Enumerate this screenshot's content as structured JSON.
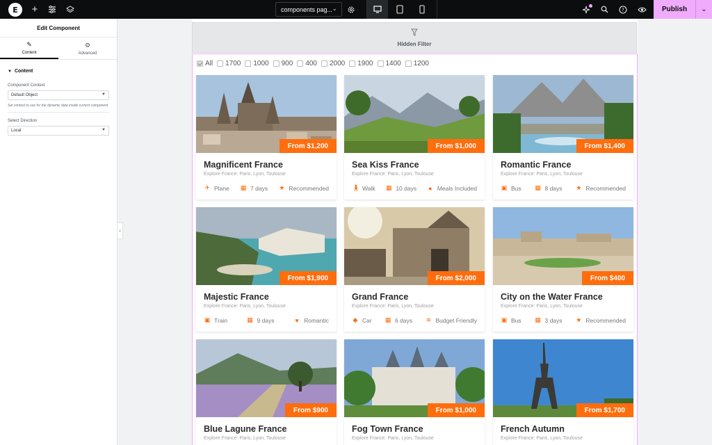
{
  "topbar": {
    "logo_letter": "E",
    "page_name": "components pag...",
    "publish_label": "Publish",
    "accent": "#f0abfc"
  },
  "panel": {
    "title": "Edit Component",
    "tabs": [
      {
        "label": "Content",
        "icon": "pencil-icon"
      },
      {
        "label": "Advanced",
        "icon": "gear-icon"
      }
    ],
    "section": "Content",
    "controls": {
      "context_label": "Component Context",
      "context_value": "Default Object",
      "context_help": "Set context to use for the dynamic data inside current component",
      "direction_label": "Select Direction",
      "direction_value": "Local"
    }
  },
  "canvas": {
    "hidden_filter_label": "Hidden Filter",
    "filters": [
      "All",
      "1700",
      "1000",
      "900",
      "400",
      "2000",
      "1900",
      "1400",
      "1200"
    ],
    "accent": "#ff6d0d"
  },
  "cards": [
    {
      "title": "Magnificent France",
      "subtitle": "Explore France: Paris, Lyon, Toulouse",
      "price": "From $1,200",
      "meta": [
        "Plane",
        "7 days",
        "Recommended"
      ],
      "icons": [
        "plane-icon",
        "calendar-icon",
        "star-icon"
      ]
    },
    {
      "title": "Sea Kiss France",
      "subtitle": "Explore France: Paris, Lyon, Toulouse",
      "price": "From $1,000",
      "meta": [
        "Walk",
        "10 days",
        "Meals Included"
      ],
      "icons": [
        "walk-icon",
        "calendar-icon",
        "apple-icon"
      ]
    },
    {
      "title": "Romantic France",
      "subtitle": "Explore France: Paris, Lyon, Toulouse",
      "price": "From $1,400",
      "meta": [
        "Bus",
        "8 days",
        "Recommended"
      ],
      "icons": [
        "bus-icon",
        "calendar-icon",
        "star-icon"
      ]
    },
    {
      "title": "Majestic France",
      "subtitle": "Explore France: Paris, Lyon, Toulouse",
      "price": "From $1,900",
      "meta": [
        "Train",
        "9 days",
        "Romantic"
      ],
      "icons": [
        "train-icon",
        "calendar-icon",
        "heart-icon"
      ]
    },
    {
      "title": "Grand France",
      "subtitle": "Explore France: Paris, Lyon, Toulouse",
      "price": "From $2,000",
      "meta": [
        "Car",
        "6 days",
        "Budget Friendly"
      ],
      "icons": [
        "car-icon",
        "calendar-icon",
        "coins-icon"
      ]
    },
    {
      "title": "City on the Water France",
      "subtitle": "Explore France: Paris, Lyon, Toulouse",
      "price": "From $400",
      "meta": [
        "Bus",
        "3 days",
        "Recommended"
      ],
      "icons": [
        "bus-icon",
        "calendar-icon",
        "star-icon"
      ]
    },
    {
      "title": "Blue Lagune France",
      "subtitle": "Explore France: Paris, Lyon, Toulouse",
      "price": "From $900",
      "meta": [],
      "icons": []
    },
    {
      "title": "Fog Town France",
      "subtitle": "Explore France: Paris, Lyon, Toulouse",
      "price": "From $1,000",
      "meta": [],
      "icons": []
    },
    {
      "title": "French Autumn",
      "subtitle": "Explore France: Paris, Lyon, Toulouse",
      "price": "From $1,700",
      "meta": [],
      "icons": []
    }
  ]
}
